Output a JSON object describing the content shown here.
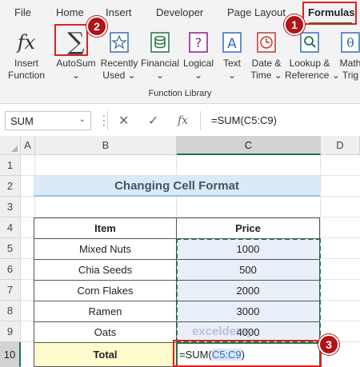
{
  "ribbon": {
    "tabs": [
      "File",
      "Home",
      "Insert",
      "Developer",
      "Page Layout",
      "Formulas"
    ],
    "active_tab": "Formulas",
    "buttons": {
      "insert_function": [
        "Insert",
        "Function"
      ],
      "autosum": [
        "AutoSum",
        "⌄"
      ],
      "recently_used": [
        "Recently",
        "Used ⌄"
      ],
      "financial": [
        "Financial",
        "⌄"
      ],
      "logical": [
        "Logical",
        "⌄"
      ],
      "text": [
        "Text",
        "⌄"
      ],
      "date_time": [
        "Date &",
        "Time ⌄"
      ],
      "lookup_reference": [
        "Lookup &",
        "Reference ⌄"
      ],
      "math_trig": [
        "Math",
        "Trig"
      ]
    },
    "group_label": "Function Library",
    "badges": {
      "formulas": "1",
      "autosum": "2",
      "cell": "3"
    }
  },
  "formula_bar": {
    "name_box": "SUM",
    "name_caret": "⌄",
    "cancel_icon": "✕",
    "enter_icon": "✓",
    "fx_icon": "fx",
    "formula": "=SUM(C5:C9)"
  },
  "sheet": {
    "columns": [
      "A",
      "B",
      "C",
      "D"
    ],
    "rows": [
      "1",
      "2",
      "3",
      "4",
      "5",
      "6",
      "7",
      "8",
      "9",
      "10"
    ],
    "title": "Changing Cell Format",
    "headers": {
      "item": "Item",
      "price": "Price"
    },
    "items": [
      {
        "name": "Mixed Nuts",
        "price": "1000"
      },
      {
        "name": "Chia Seeds",
        "price": "500"
      },
      {
        "name": "Corn Flakes",
        "price": "2000"
      },
      {
        "name": "Ramen",
        "price": "3000"
      },
      {
        "name": "Oats",
        "price": "4000"
      }
    ],
    "total_label": "Total",
    "editing_formula": {
      "prefix": "=SUM(",
      "ref": "C5:C9",
      "suffix": ")"
    },
    "watermark": "exceldemy"
  },
  "colors": {
    "accent": "#217346",
    "highlight_box": "#e02020",
    "badge": "#b01418"
  }
}
